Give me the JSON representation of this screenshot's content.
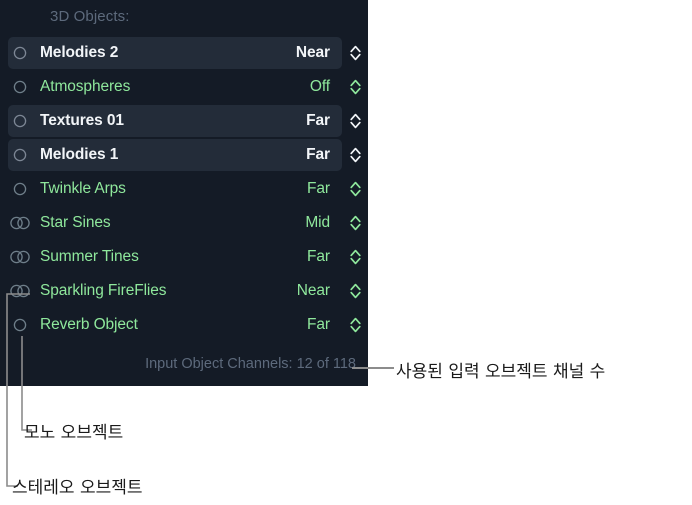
{
  "panel": {
    "header": "3D Objects:",
    "footer": "Input Object Channels: 12 of 118",
    "colors": {
      "panel_background": "#141b26",
      "row_alt_background": "#232c39",
      "object_green": "#8fe89c",
      "selected_text": "#f2f5f8",
      "muted_label": "#5d6a7c",
      "leader_line": "#8c8c8c"
    },
    "objects": [
      {
        "name": "Melodies 2",
        "value": "Near",
        "channel_type": "mono",
        "selected": true,
        "alt_row": true
      },
      {
        "name": "Atmospheres",
        "value": "Off",
        "channel_type": "mono",
        "selected": false,
        "alt_row": false
      },
      {
        "name": "Textures 01",
        "value": "Far",
        "channel_type": "mono",
        "selected": true,
        "alt_row": true
      },
      {
        "name": "Melodies 1",
        "value": "Far",
        "channel_type": "mono",
        "selected": true,
        "alt_row": true
      },
      {
        "name": "Twinkle Arps",
        "value": "Far",
        "channel_type": "mono",
        "selected": false,
        "alt_row": false
      },
      {
        "name": "Star Sines",
        "value": "Mid",
        "channel_type": "stereo",
        "selected": false,
        "alt_row": false
      },
      {
        "name": "Summer Tines",
        "value": "Far",
        "channel_type": "stereo",
        "selected": false,
        "alt_row": false
      },
      {
        "name": "Sparkling FireFlies",
        "value": "Near",
        "channel_type": "stereo",
        "selected": false,
        "alt_row": false
      },
      {
        "name": "Reverb Object",
        "value": "Far",
        "channel_type": "mono",
        "selected": false,
        "alt_row": false
      }
    ]
  },
  "annotations": {
    "channels": "사용된 입력 오브젝트 채널 수",
    "mono": "모노 오브젝트",
    "stereo": "스테레오 오브젝트"
  }
}
